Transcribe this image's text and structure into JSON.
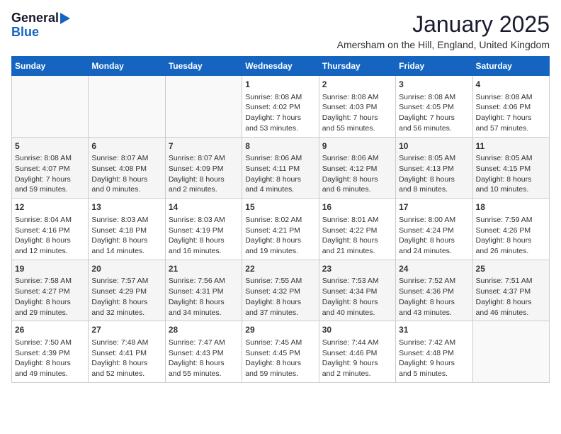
{
  "logo": {
    "general": "General",
    "blue": "Blue"
  },
  "title": "January 2025",
  "subtitle": "Amersham on the Hill, England, United Kingdom",
  "headers": [
    "Sunday",
    "Monday",
    "Tuesday",
    "Wednesday",
    "Thursday",
    "Friday",
    "Saturday"
  ],
  "weeks": [
    [
      {
        "day": "",
        "info": ""
      },
      {
        "day": "",
        "info": ""
      },
      {
        "day": "",
        "info": ""
      },
      {
        "day": "1",
        "info": "Sunrise: 8:08 AM\nSunset: 4:02 PM\nDaylight: 7 hours\nand 53 minutes."
      },
      {
        "day": "2",
        "info": "Sunrise: 8:08 AM\nSunset: 4:03 PM\nDaylight: 7 hours\nand 55 minutes."
      },
      {
        "day": "3",
        "info": "Sunrise: 8:08 AM\nSunset: 4:05 PM\nDaylight: 7 hours\nand 56 minutes."
      },
      {
        "day": "4",
        "info": "Sunrise: 8:08 AM\nSunset: 4:06 PM\nDaylight: 7 hours\nand 57 minutes."
      }
    ],
    [
      {
        "day": "5",
        "info": "Sunrise: 8:08 AM\nSunset: 4:07 PM\nDaylight: 7 hours\nand 59 minutes."
      },
      {
        "day": "6",
        "info": "Sunrise: 8:07 AM\nSunset: 4:08 PM\nDaylight: 8 hours\nand 0 minutes."
      },
      {
        "day": "7",
        "info": "Sunrise: 8:07 AM\nSunset: 4:09 PM\nDaylight: 8 hours\nand 2 minutes."
      },
      {
        "day": "8",
        "info": "Sunrise: 8:06 AM\nSunset: 4:11 PM\nDaylight: 8 hours\nand 4 minutes."
      },
      {
        "day": "9",
        "info": "Sunrise: 8:06 AM\nSunset: 4:12 PM\nDaylight: 8 hours\nand 6 minutes."
      },
      {
        "day": "10",
        "info": "Sunrise: 8:05 AM\nSunset: 4:13 PM\nDaylight: 8 hours\nand 8 minutes."
      },
      {
        "day": "11",
        "info": "Sunrise: 8:05 AM\nSunset: 4:15 PM\nDaylight: 8 hours\nand 10 minutes."
      }
    ],
    [
      {
        "day": "12",
        "info": "Sunrise: 8:04 AM\nSunset: 4:16 PM\nDaylight: 8 hours\nand 12 minutes."
      },
      {
        "day": "13",
        "info": "Sunrise: 8:03 AM\nSunset: 4:18 PM\nDaylight: 8 hours\nand 14 minutes."
      },
      {
        "day": "14",
        "info": "Sunrise: 8:03 AM\nSunset: 4:19 PM\nDaylight: 8 hours\nand 16 minutes."
      },
      {
        "day": "15",
        "info": "Sunrise: 8:02 AM\nSunset: 4:21 PM\nDaylight: 8 hours\nand 19 minutes."
      },
      {
        "day": "16",
        "info": "Sunrise: 8:01 AM\nSunset: 4:22 PM\nDaylight: 8 hours\nand 21 minutes."
      },
      {
        "day": "17",
        "info": "Sunrise: 8:00 AM\nSunset: 4:24 PM\nDaylight: 8 hours\nand 24 minutes."
      },
      {
        "day": "18",
        "info": "Sunrise: 7:59 AM\nSunset: 4:26 PM\nDaylight: 8 hours\nand 26 minutes."
      }
    ],
    [
      {
        "day": "19",
        "info": "Sunrise: 7:58 AM\nSunset: 4:27 PM\nDaylight: 8 hours\nand 29 minutes."
      },
      {
        "day": "20",
        "info": "Sunrise: 7:57 AM\nSunset: 4:29 PM\nDaylight: 8 hours\nand 32 minutes."
      },
      {
        "day": "21",
        "info": "Sunrise: 7:56 AM\nSunset: 4:31 PM\nDaylight: 8 hours\nand 34 minutes."
      },
      {
        "day": "22",
        "info": "Sunrise: 7:55 AM\nSunset: 4:32 PM\nDaylight: 8 hours\nand 37 minutes."
      },
      {
        "day": "23",
        "info": "Sunrise: 7:53 AM\nSunset: 4:34 PM\nDaylight: 8 hours\nand 40 minutes."
      },
      {
        "day": "24",
        "info": "Sunrise: 7:52 AM\nSunset: 4:36 PM\nDaylight: 8 hours\nand 43 minutes."
      },
      {
        "day": "25",
        "info": "Sunrise: 7:51 AM\nSunset: 4:37 PM\nDaylight: 8 hours\nand 46 minutes."
      }
    ],
    [
      {
        "day": "26",
        "info": "Sunrise: 7:50 AM\nSunset: 4:39 PM\nDaylight: 8 hours\nand 49 minutes."
      },
      {
        "day": "27",
        "info": "Sunrise: 7:48 AM\nSunset: 4:41 PM\nDaylight: 8 hours\nand 52 minutes."
      },
      {
        "day": "28",
        "info": "Sunrise: 7:47 AM\nSunset: 4:43 PM\nDaylight: 8 hours\nand 55 minutes."
      },
      {
        "day": "29",
        "info": "Sunrise: 7:45 AM\nSunset: 4:45 PM\nDaylight: 8 hours\nand 59 minutes."
      },
      {
        "day": "30",
        "info": "Sunrise: 7:44 AM\nSunset: 4:46 PM\nDaylight: 9 hours\nand 2 minutes."
      },
      {
        "day": "31",
        "info": "Sunrise: 7:42 AM\nSunset: 4:48 PM\nDaylight: 9 hours\nand 5 minutes."
      },
      {
        "day": "",
        "info": ""
      }
    ]
  ]
}
